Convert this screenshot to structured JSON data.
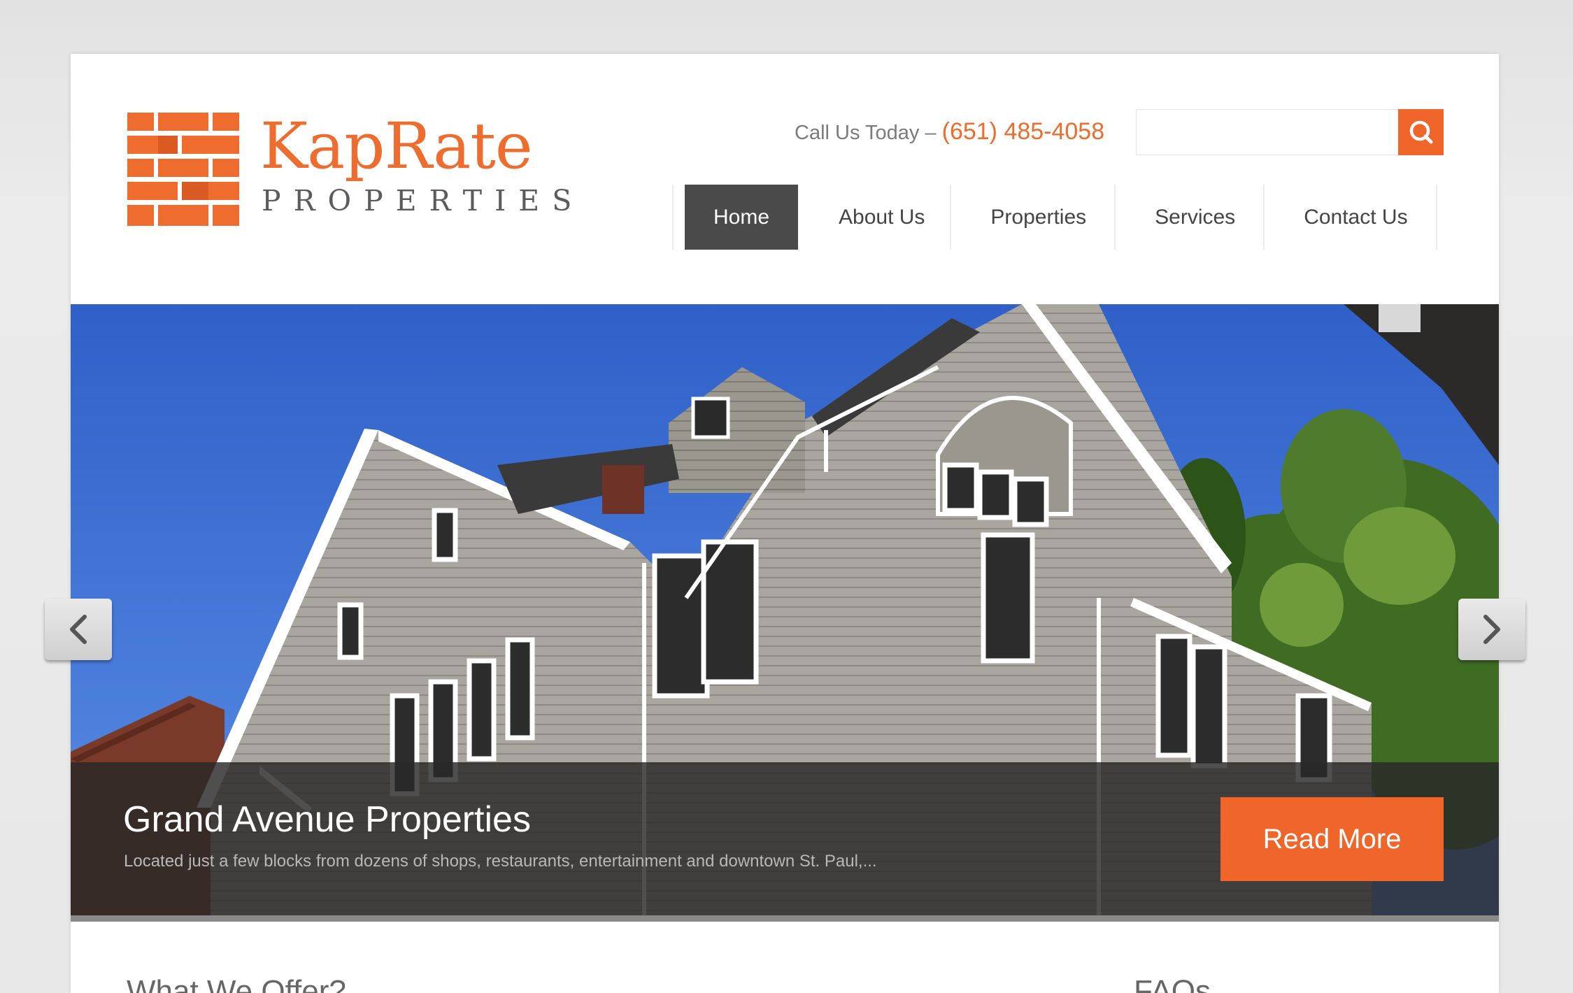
{
  "brand": {
    "name": "KapRate",
    "sub": "PROPERTIES",
    "color": "#ee6c2d"
  },
  "header": {
    "call_label": "Call Us Today – ",
    "phone": "(651) 485-4058"
  },
  "search": {
    "placeholder": "",
    "icon": "search-icon"
  },
  "nav": {
    "items": [
      {
        "label": "Home",
        "active": true
      },
      {
        "label": "About Us",
        "active": false
      },
      {
        "label": "Properties",
        "active": false
      },
      {
        "label": "Services",
        "active": false
      },
      {
        "label": "Contact Us",
        "active": false
      }
    ]
  },
  "slider": {
    "title": "Grand Avenue Properties",
    "text": "Located just a few blocks from dozens of shops, restaurants, entertainment and downtown St. Paul,...",
    "button": "Read More",
    "prev_icon": "chevron-left-icon",
    "next_icon": "chevron-right-icon"
  },
  "sections": {
    "offer": "What We Offer?",
    "faqs": "FAQs"
  },
  "colors": {
    "accent": "#f0652a",
    "nav_active": "#4a4a4a"
  }
}
